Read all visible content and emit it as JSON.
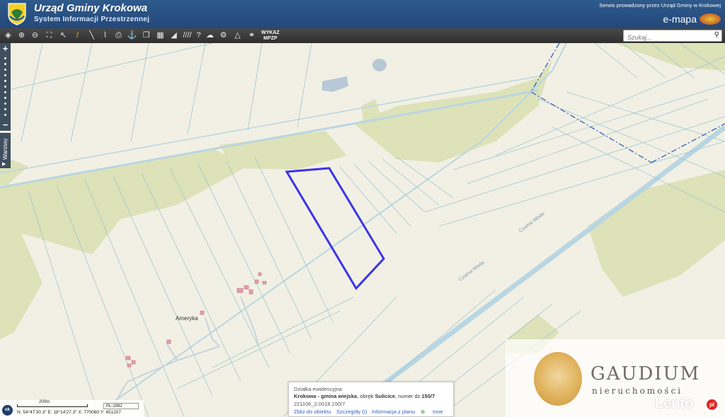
{
  "header": {
    "title": "Urząd Gminy Krokowa",
    "subtitle": "System Informacji Przestrzennej",
    "service_note": "Serwis prowadzony przez Urząd Gminy w Krokowej",
    "brand": "e-mapa"
  },
  "toolbar": {
    "wykaz_line1": "WYKAZ",
    "wykaz_line2": "MPZP",
    "search_placeholder": "Szukaj...",
    "icons": [
      "layers-icon",
      "zoom-in-icon",
      "zoom-out-icon",
      "zoom-extent-icon",
      "select-arrow-icon",
      "pencil-icon",
      "measure-line-icon",
      "measure-area-icon",
      "print-icon",
      "anchor-icon",
      "copy-icon",
      "layout-icon",
      "shape-icon",
      "hatch-icon",
      "help-icon",
      "cloud-icon",
      "settings-icon",
      "compass-icon",
      "share-icon"
    ]
  },
  "map": {
    "layers_tab": "Warstwy",
    "place_label": "Ameryka",
    "road_label_1": "Czarna Woda",
    "road_label_2": "Czarna Woda",
    "colors": {
      "background": "#f2f0e4",
      "forest": "#dde2b8",
      "parcel_line": "#9ec7d2",
      "parcel_highlight": "#3a35e8",
      "water": "#b7c9d6",
      "boundary": "#3060c0"
    }
  },
  "popup": {
    "title": "Działka ewidencyjna",
    "line2_prefix": "Krokowa - gmina wiejska",
    "line2_mid": ", obręb ",
    "line2_obreb": "Sulicice",
    "line2_num_prefix": ", numer dz.",
    "line2_num": "150/7",
    "line3": "221106_2.0018.150/7",
    "link_zoom": "Zbliż do obiektu",
    "link_details": "Szczegóły (I)",
    "link_plan": "Informacja z planu",
    "link_other": "Inne"
  },
  "statusbar": {
    "ok_label": "ok",
    "scale_label": "200m",
    "crs": "PL-1992",
    "coords": "N: 54°47'30.3\"  E: 18°14'27.3\"  X: 770060    Y: 451207"
  },
  "watermark": {
    "name": "GAUDIUM",
    "sub": "nieruchomości",
    "site": "Lento",
    "site_badge": "pl"
  }
}
